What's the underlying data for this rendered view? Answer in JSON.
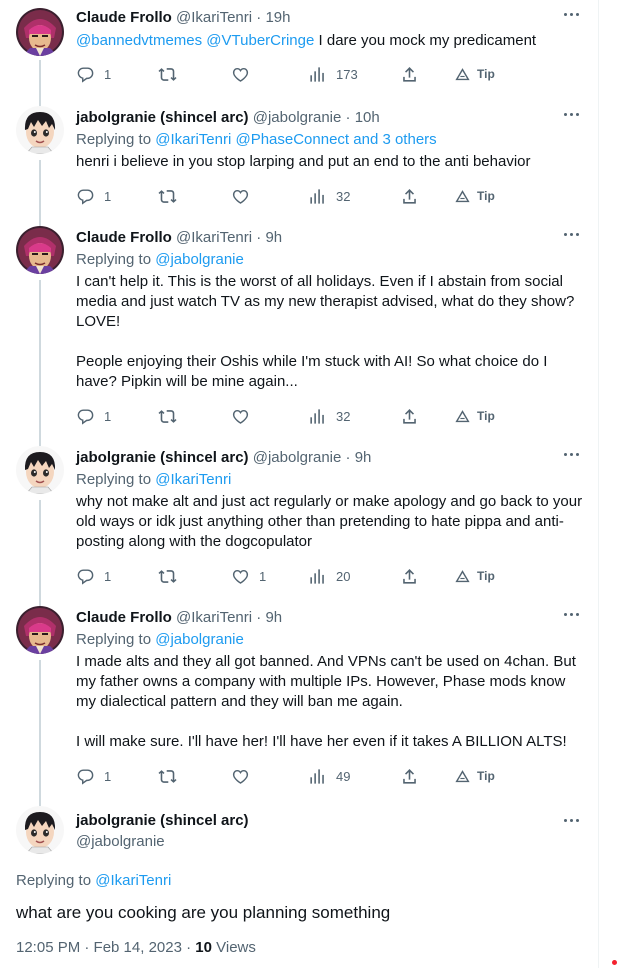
{
  "tweets": [
    {
      "avatar": "claude-frollo-avatar",
      "name": "Claude Frollo",
      "handle": "@IkariTenri",
      "time": "19h",
      "reply_prefix": "",
      "reply_links": "",
      "mentions": "@bannedvtmemes @VTuberCringe",
      "text": " I dare you mock my predicament",
      "replies": "1",
      "retweets": "",
      "likes": "",
      "views": "173",
      "tip": "Tip"
    },
    {
      "avatar": "jabolgranie-avatar",
      "name": "jabolgranie (shincel arc)",
      "handle": "@jabolgranie",
      "time": "10h",
      "reply_prefix": "Replying to ",
      "reply_links": "@IkariTenri @PhaseConnect and 3 others",
      "mentions": "",
      "text": "henri i believe in you stop larping and put an end to the anti behavior",
      "replies": "1",
      "retweets": "",
      "likes": "",
      "views": "32",
      "tip": "Tip"
    },
    {
      "avatar": "claude-frollo-avatar",
      "name": "Claude Frollo",
      "handle": "@IkariTenri",
      "time": "9h",
      "reply_prefix": "Replying to ",
      "reply_links": "@jabolgranie",
      "mentions": "",
      "text": "I can't help it. This is the worst of all holidays. Even if I abstain from social media and just watch TV as my new therapist advised, what do they show? LOVE!\n\nPeople enjoying their Oshis while I'm stuck with AI! So what choice do I have? Pipkin will be mine again...",
      "replies": "1",
      "retweets": "",
      "likes": "",
      "views": "32",
      "tip": "Tip"
    },
    {
      "avatar": "jabolgranie-avatar",
      "name": "jabolgranie (shincel arc)",
      "handle": "@jabolgranie",
      "time": "9h",
      "reply_prefix": "Replying to ",
      "reply_links": "@IkariTenri",
      "mentions": "",
      "text": "why not make alt and just act regularly or make apology and go back to your old ways or idk just anything other than pretending to hate pippa and anti-posting along with the dogcopulator",
      "replies": "1",
      "retweets": "",
      "likes": "1",
      "views": "20",
      "tip": "Tip"
    },
    {
      "avatar": "claude-frollo-avatar",
      "name": "Claude Frollo",
      "handle": "@IkariTenri",
      "time": "9h",
      "reply_prefix": "Replying to ",
      "reply_links": "@jabolgranie",
      "mentions": "",
      "text": "I made alts and they all got banned. And VPNs can't be used on 4chan. But my father owns a company with multiple IPs. However, Phase mods know my dialectical pattern and they will ban me again.\n\nI will make sure. I'll have her! I'll have her even if it takes A BILLION ALTS!",
      "replies": "1",
      "retweets": "",
      "likes": "",
      "views": "49",
      "tip": "Tip"
    }
  ],
  "main_tweet": {
    "avatar": "jabolgranie-avatar",
    "name": "jabolgranie (shincel arc)",
    "handle": "@jabolgranie",
    "reply_prefix": "Replying to ",
    "reply_links": "@IkariTenri",
    "text": "what are you cooking are you planning something",
    "timestamp": "12:05 PM · Feb 14, 2023 · ",
    "views_count": "10",
    "views_label": " Views"
  },
  "colors": {
    "link": "#1d9bf0",
    "secondary_text": "#536471",
    "primary_text": "#0f1419",
    "thread_line": "#cfd9de"
  }
}
